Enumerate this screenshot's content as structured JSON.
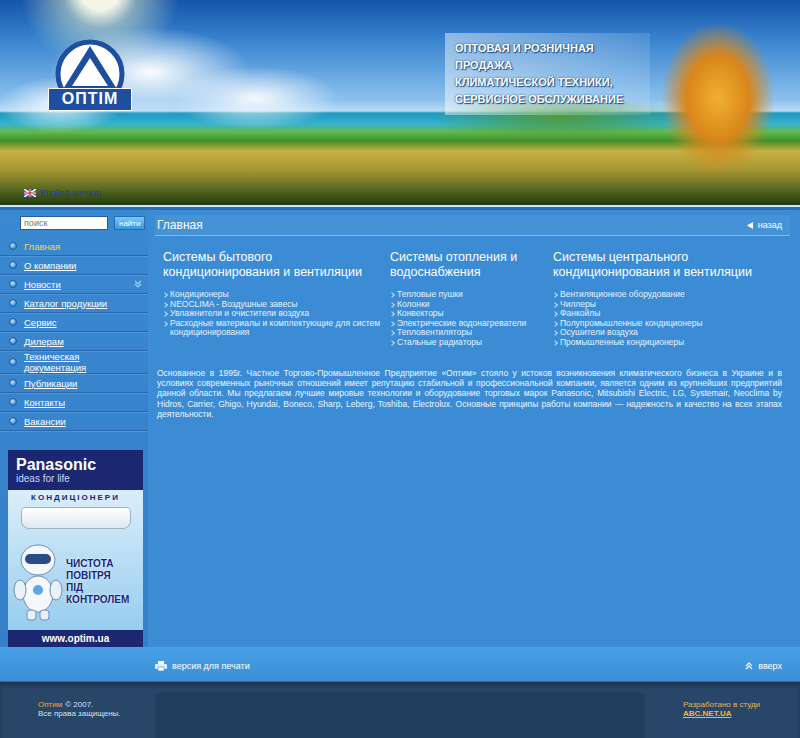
{
  "header": {
    "logo_text": "ОПТІМ",
    "tagline": [
      "ОПТОВАЯ И РОЗНИЧНАЯ ПРОДАЖА",
      "КЛИМАТИЧЕСКОЙ ТЕХНИКИ,",
      "СЕРВИСНОЕ ОБСЛУЖИВАНИЕ"
    ],
    "language_link": "English version"
  },
  "search": {
    "placeholder": "поиск",
    "button": "найти"
  },
  "sidebar": {
    "items": [
      {
        "label": "Главная",
        "selected": true,
        "has_submenu": false
      },
      {
        "label": "О компании",
        "selected": false,
        "has_submenu": false
      },
      {
        "label": "Новости",
        "selected": false,
        "has_submenu": true
      },
      {
        "label": "Каталог продукции",
        "selected": false,
        "has_submenu": false
      },
      {
        "label": "Сервис",
        "selected": false,
        "has_submenu": false
      },
      {
        "label": "Дилерам",
        "selected": false,
        "has_submenu": false
      },
      {
        "label": "Техническая документация",
        "selected": false,
        "has_submenu": false
      },
      {
        "label": "Публикации",
        "selected": false,
        "has_submenu": false
      },
      {
        "label": "Контакты",
        "selected": false,
        "has_submenu": false
      },
      {
        "label": "Вакансии",
        "selected": false,
        "has_submenu": false
      }
    ]
  },
  "banner": {
    "brand": "Panasonic",
    "slogan": "ideas for life",
    "product": "КОНДИЦІОНЕРИ",
    "caption": [
      "ЧИСТОТА",
      "ПОВІТРЯ",
      "ПІД",
      "КОНТРОЛЕМ"
    ],
    "url": "www.optim.ua"
  },
  "content": {
    "title": "Главная",
    "back": "назад",
    "columns": [
      {
        "heading": "Системы бытового кондиционирования и вентиляции",
        "items": [
          "Кондиционеры",
          "NEOCLIMA - Воздушные завесы",
          "Увлажнители и очистители воздуха",
          "Расходные материалы и комплектующие для систем кондиционирования"
        ]
      },
      {
        "heading": "Системы отопления и водоснабжения",
        "items": [
          "Тепловые пушки",
          "Колонки",
          "Конвекторы",
          "Электрические водонагреватели",
          "Тепловентиляторы",
          "Стальные радиаторы"
        ]
      },
      {
        "heading": "Системы центрального кондиционирования и вентиляции",
        "items": [
          "Вентиляционное оборудование",
          "Чиллеры",
          "Фанкойлы",
          "Полупромышленные кондиционеры",
          "Осушители воздуха",
          "Промышленные кондиционеры"
        ]
      }
    ],
    "paragraph": "Основанное в 1995г. Частное Торгово-Промышленное Предприятие «Оптим» стояло у истоков возникновения климатического бизнеса в Украине и в условиях современных рыночных отношений имеет репутацию стабильной и профессиональной компании, является одним из крупнейших предприятий данной области. Мы предлагаем лучшие мировые технологии и оборудование торговых марок Panasonic, Mitsubishi Electric, LG, Systemair, Neoclima by Hidros, Carrier, Ghigo, Hyundai, Boneco, Sharp, Leberg, Toshiba, Electrolux. Основные принципы работы компании — надежность и качество на всех этапах деятельности."
  },
  "bottom_bar": {
    "print": "версия для печати",
    "top": "вверх"
  },
  "footer": {
    "brand": "Оптим",
    "copyright": "© 2007.",
    "rights": "Все права защищены.",
    "credit": "Разработано в студи",
    "studio": "ABC.NET.UA"
  }
}
